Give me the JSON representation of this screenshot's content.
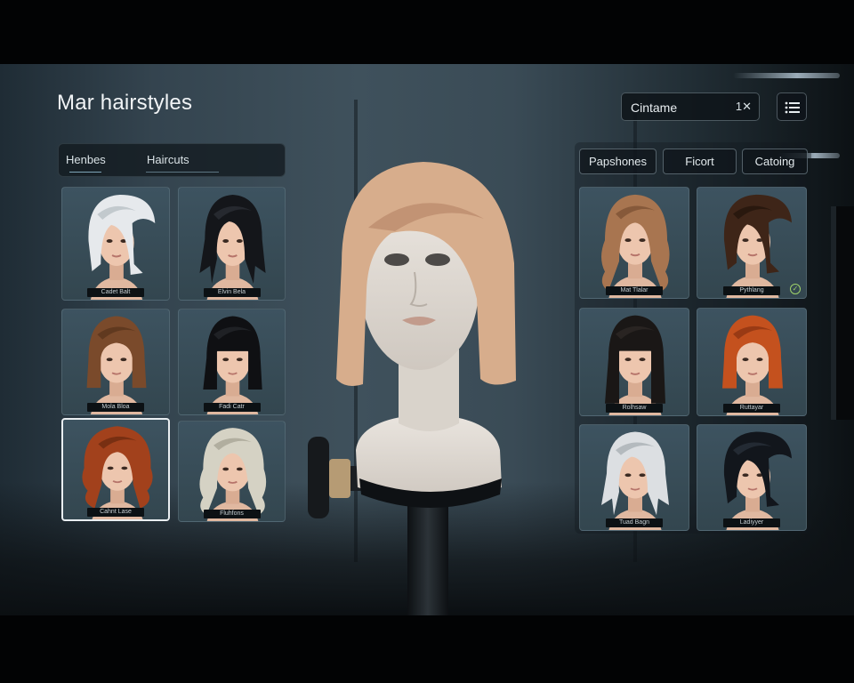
{
  "app": {
    "title": "Mar hairstyles"
  },
  "left_tabs": [
    {
      "label": "Henbes",
      "active": true
    },
    {
      "label": "Haircuts",
      "active": false
    }
  ],
  "search": {
    "value": "Cintame",
    "clear_label": "1✕"
  },
  "menu": {
    "icon": "list-icon"
  },
  "filter_chips": [
    {
      "label": "Papshones"
    },
    {
      "label": "Ficort"
    },
    {
      "label": "Catoing"
    }
  ],
  "left_cards": [
    {
      "label": "Cadet Balt",
      "hair": "#e6e9ec",
      "shade": "#b9c0c6",
      "style": "bob-swoop"
    },
    {
      "label": "Elvin Bela",
      "hair": "#14161a",
      "shade": "#2a2e35",
      "style": "shag"
    },
    {
      "label": "Mola Bloa",
      "hair": "#7a4a2b",
      "shade": "#5a341d",
      "style": "bob"
    },
    {
      "label": "Fadi Catr",
      "hair": "#0f1013",
      "shade": "#23252a",
      "style": "bangs-bob"
    },
    {
      "label": "Cahnt Lase",
      "hair": "#a2411c",
      "shade": "#6e2a10",
      "style": "curly",
      "selected": true
    },
    {
      "label": "Fluhfons",
      "hair": "#d5d2c4",
      "shade": "#a8a596",
      "style": "wavy"
    }
  ],
  "right_cards": [
    {
      "label": "Mat Tlalar",
      "hair": "#a87550",
      "shade": "#7d5335",
      "style": "wavy-long"
    },
    {
      "label": "Pythlang",
      "hair": "#3e2518",
      "shade": "#24150d",
      "style": "side-swept",
      "badge": "✓"
    },
    {
      "label": "Rolhsaw",
      "hair": "#1a1716",
      "shade": "#2d2826",
      "style": "bangs-long"
    },
    {
      "label": "Ruttayar",
      "hair": "#c4511e",
      "shade": "#8e3411",
      "style": "bob"
    },
    {
      "label": "Tuad Bagn",
      "hair": "#dcdfe2",
      "shade": "#aab0b5",
      "style": "shag-light"
    },
    {
      "label": "Ladiyyer",
      "hair": "#12161c",
      "shade": "#28303a",
      "style": "swoop"
    }
  ],
  "preview": {
    "hair": "#d7ad8c",
    "shade": "#b9876a",
    "style": "angled-bob"
  },
  "colors": {
    "accent": "#7ea5b8",
    "panel": "#121a1f",
    "badge": "#9fd36b"
  }
}
